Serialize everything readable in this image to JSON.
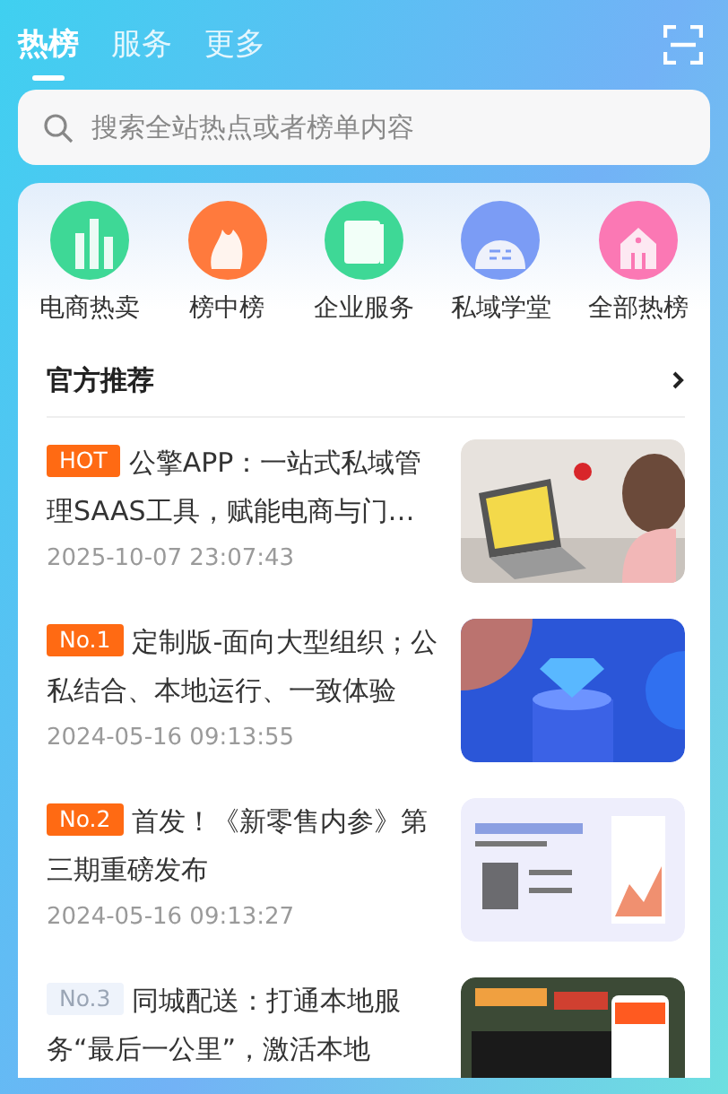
{
  "tabs": [
    {
      "label": "热榜",
      "selected": true
    },
    {
      "label": "服务",
      "selected": false
    },
    {
      "label": "更多",
      "selected": false
    }
  ],
  "search": {
    "placeholder": "搜索全站热点或者榜单内容"
  },
  "categories": [
    {
      "label": "电商热卖",
      "color": "#3ed896"
    },
    {
      "label": "榜中榜",
      "color": "#ff7a3d"
    },
    {
      "label": "企业服务",
      "color": "#3ed896"
    },
    {
      "label": "私域学堂",
      "color": "#7b9cf5"
    },
    {
      "label": "全部热榜",
      "color": "#fb78b4"
    }
  ],
  "section": {
    "title": "官方推荐"
  },
  "articles": [
    {
      "tag": "HOT",
      "highlighted": true,
      "title": "公擎APP：一站式私域管理SAAS工具，赋能电商与门…",
      "time": "2025-10-07 23:07:43",
      "kind": "picture"
    },
    {
      "tag": "No.1",
      "highlighted": true,
      "title": "定制版-面向大型组织；公私结合、本地运行、一致体验",
      "time": "2024-05-16 09:13:55",
      "kind": "picture"
    },
    {
      "tag": "No.2",
      "highlighted": true,
      "title": "首发！《新零售内参》第三期重磅发布",
      "time": "2024-05-16 09:13:27",
      "kind": "picture"
    },
    {
      "tag": "No.3",
      "highlighted": false,
      "title": "同城配送：打通本地服务“最后一公里”，激活本地",
      "kind": "picture"
    }
  ]
}
